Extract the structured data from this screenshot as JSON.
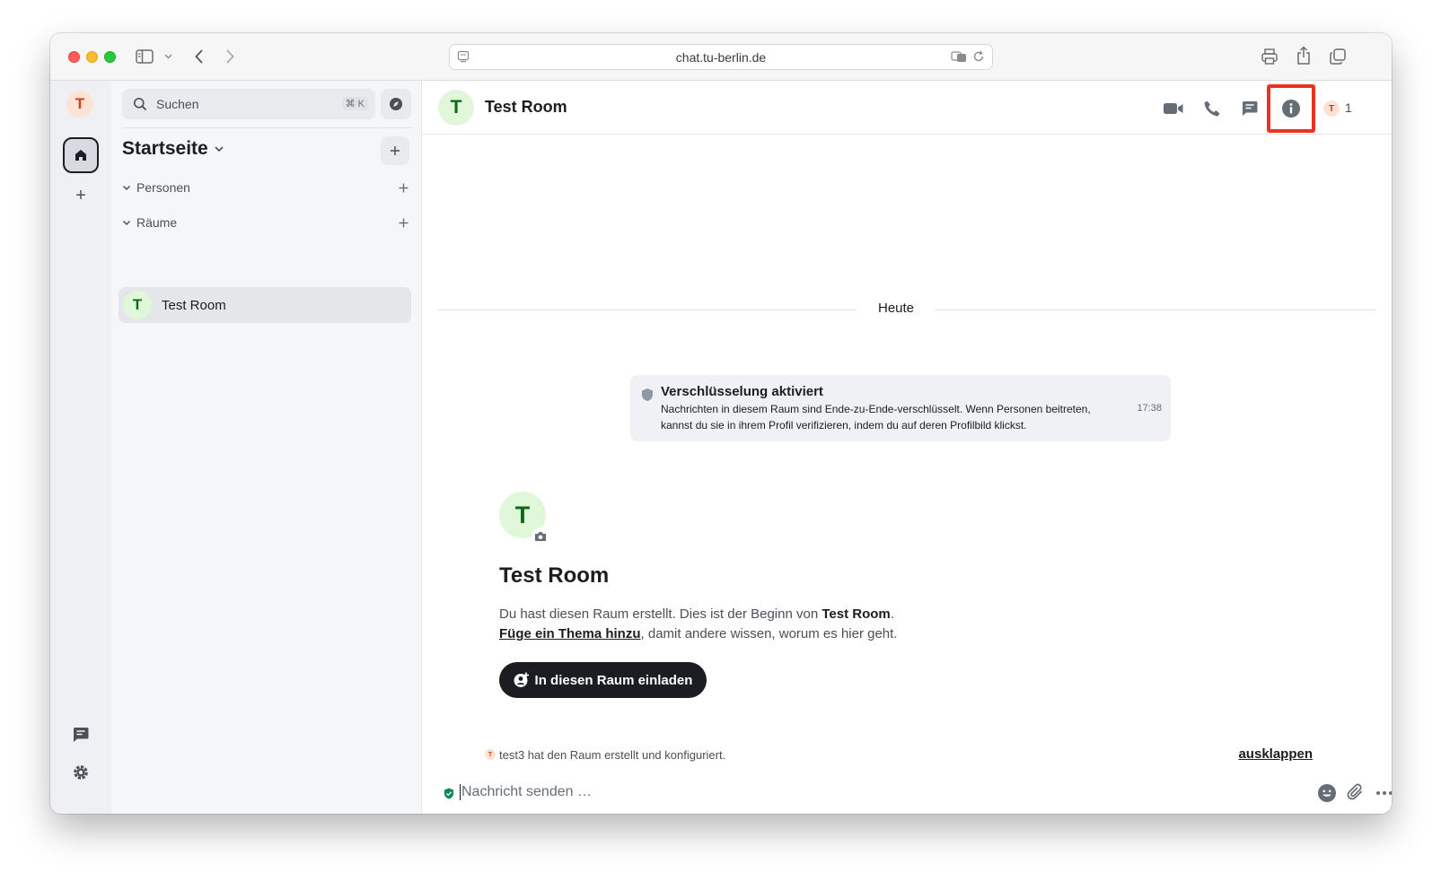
{
  "browser": {
    "url": "chat.tu-berlin.de"
  },
  "spacebar": {
    "user_initial": "T",
    "add_label": "+"
  },
  "roomlist": {
    "search_label": "Suchen",
    "search_shortcut": "⌘ K",
    "title": "Startseite",
    "sections": [
      {
        "label": "Personen"
      },
      {
        "label": "Räume"
      }
    ],
    "rooms": [
      {
        "initial": "T",
        "name": "Test Room"
      }
    ]
  },
  "header": {
    "room_initial": "T",
    "room_name": "Test Room",
    "member_initial": "T",
    "member_count": "1",
    "highlight_color": "#ea3323"
  },
  "timeline": {
    "day_label": "Heute",
    "encryption": {
      "title": "Verschlüsselung aktiviert",
      "body": "Nachrichten in diesem Raum sind Ende-zu-Ende-verschlüsselt. Wenn Personen beitreten, kannst du sie in ihrem Profil verifizieren, indem du auf deren Profilbild klickst.",
      "time": "17:38"
    },
    "new_room": {
      "initial": "T",
      "title": "Test Room",
      "line1_prefix": "Du hast diesen Raum erstellt. Dies ist der Beginn von ",
      "line1_room": "Test Room",
      "line1_suffix": ".",
      "topic_link": "Füge ein Thema hinzu",
      "line2_suffix": ", damit andere wissen, worum es hier geht.",
      "invite_label": "In diesen Raum einladen"
    },
    "summary": {
      "initial": "T",
      "text": "test3 hat den Raum erstellt und konfiguriert.",
      "expand_label": "ausklappen"
    }
  },
  "composer": {
    "placeholder": "Nachricht senden …"
  }
}
